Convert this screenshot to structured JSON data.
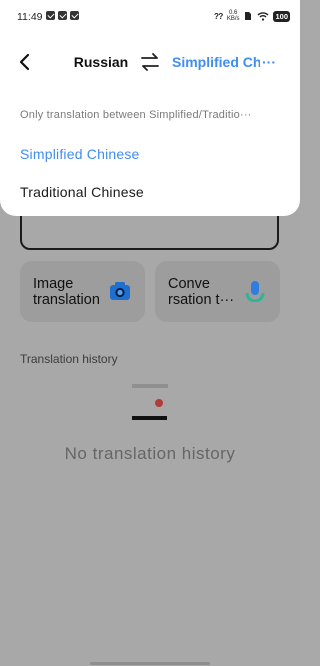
{
  "status_bar": {
    "time": "11:49",
    "net_label": "??",
    "speed_top": "0.6",
    "speed_bottom": "KB/s",
    "battery": "100"
  },
  "toolbar": {
    "source_language": "Russian",
    "target_language": "Simplified Chi",
    "target_ellipsis": "···"
  },
  "language_sheet": {
    "note": "Only translation between Simplified/Traditio",
    "note_ellipsis": "···",
    "options": [
      {
        "label": "Simplified Chinese",
        "selected": true
      },
      {
        "label": "Traditional Chinese",
        "selected": false
      }
    ]
  },
  "features": {
    "image_translation": "Image translation",
    "conversation_translation": "Conve rsation t···"
  },
  "history": {
    "title": "Translation history",
    "empty_text": "No translation history"
  },
  "colors": {
    "accent": "#3f8ef0",
    "overlay": "#a8a8a8",
    "camera_icon": "#1f6fd1",
    "mic_icon": "#2f7de0",
    "empty_dot": "#b23a3a"
  },
  "icons": {
    "back": "chevron-left-icon",
    "swap": "swap-arrows-icon",
    "image_translation": "camera-icon",
    "conversation": "microphone-icon",
    "empty_history": "empty-history-icon"
  }
}
